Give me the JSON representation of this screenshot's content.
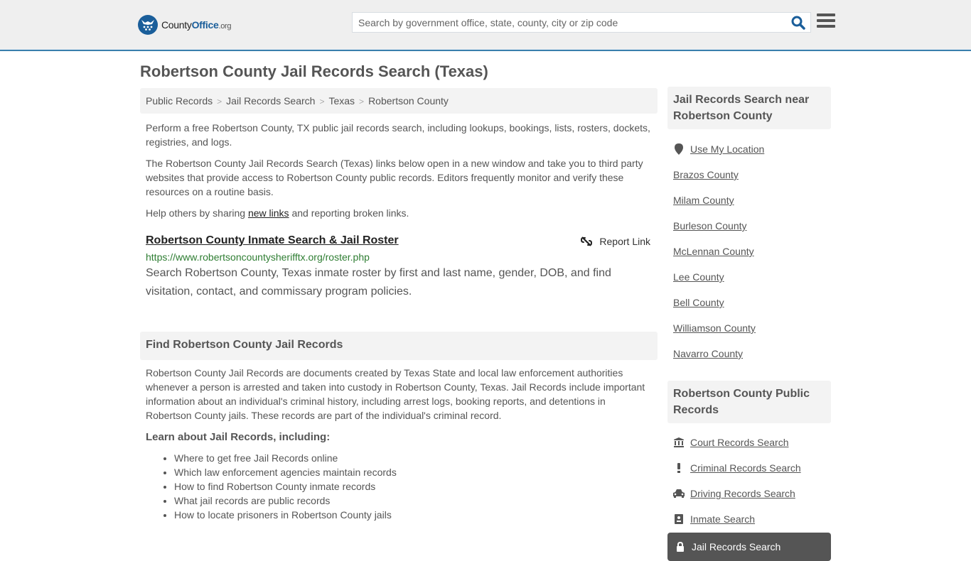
{
  "header": {
    "logo": {
      "part1": "County",
      "part2": "Office",
      "part3": ".org"
    },
    "search_placeholder": "Search by government office, state, county, city or zip code",
    "search_icon": "search-icon",
    "menu_icon": "hamburger-menu-icon",
    "accent_color": "#1a5e9a"
  },
  "page": {
    "title": "Robertson County Jail Records Search (Texas)",
    "breadcrumb": [
      "Public Records",
      "Jail Records Search",
      "Texas",
      "Robertson County"
    ],
    "intro": {
      "p1": "Perform a free Robertson County, TX public jail records search, including lookups, bookings, lists, rosters, dockets, registries, and logs.",
      "p2": "The Robertson County Jail Records Search (Texas) links below open in a new window and take you to third party websites that provide access to Robertson County public records. Editors frequently monitor and verify these resources on a routine basis.",
      "p3_before": "Help others by sharing ",
      "p3_link": "new links",
      "p3_after": " and reporting broken links."
    },
    "result": {
      "title": "Robertson County Inmate Search & Jail Roster",
      "report_label": "Report Link",
      "url": "https://www.robertsoncountysherifftx.org/roster.php",
      "description": "Search Robertson County, Texas inmate roster by first and last name, gender, DOB, and find visitation, contact, and commissary program policies."
    },
    "section": {
      "heading": "Find Robertson County Jail Records",
      "body": "Robertson County Jail Records are documents created by Texas State and local law enforcement authorities whenever a person is arrested and taken into custody in Robertson County, Texas. Jail Records include important information about an individual's criminal history, including arrest logs, booking reports, and detentions in Robertson County jails. These records are part of the individual's criminal record.",
      "learn_heading": "Learn about Jail Records, including:",
      "learn_items": [
        "Where to get free Jail Records online",
        "Which law enforcement agencies maintain records",
        "How to find Robertson County inmate records",
        "What jail records are public records",
        "How to locate prisoners in Robertson County jails"
      ]
    }
  },
  "sidebar": {
    "nearby_heading": "Jail Records Search near Robertson County",
    "use_location": "Use My Location",
    "nearby": [
      "Brazos County",
      "Milam County",
      "Burleson County",
      "McLennan County",
      "Lee County",
      "Bell County",
      "Williamson County",
      "Navarro County"
    ],
    "public_heading": "Robertson County Public Records",
    "public_links": [
      {
        "label": "Court Records Search",
        "icon": "courthouse-icon"
      },
      {
        "label": "Criminal Records Search",
        "icon": "exclamation-icon"
      },
      {
        "label": "Driving Records Search",
        "icon": "car-icon"
      },
      {
        "label": "Inmate Search",
        "icon": "id-badge-icon"
      }
    ],
    "active_link": {
      "label": "Jail Records Search",
      "icon": "lock-icon"
    }
  }
}
